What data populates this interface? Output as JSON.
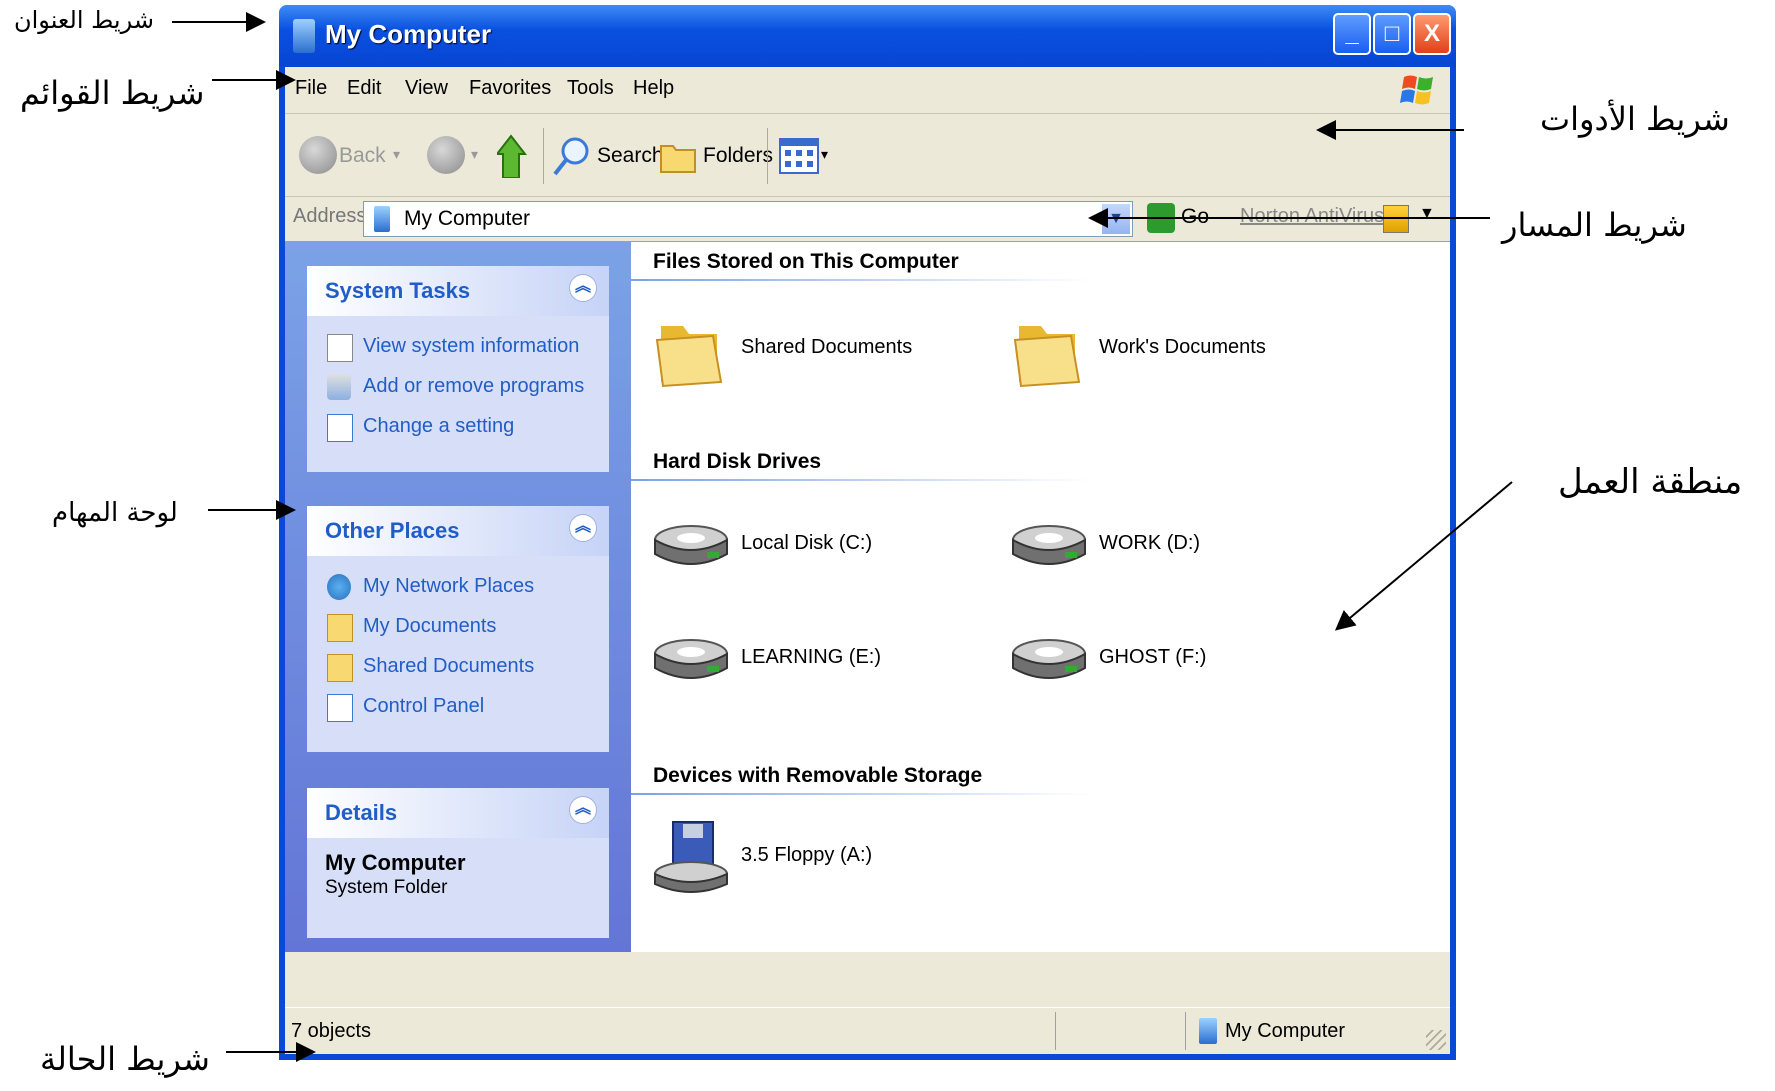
{
  "annotations": {
    "title_bar": "شريط العنوان",
    "menu_bar": "شريط القوائم",
    "toolbar": "شريط الأدوات",
    "address_bar": "شريط المسار",
    "task_pane": "لوحة المهام",
    "work_area": "منطقة العمل",
    "status_bar": "شريط الحالة"
  },
  "window": {
    "title": "My Computer",
    "buttons": {
      "minimize": "_",
      "maximize": "□",
      "close": "X"
    }
  },
  "menubar": {
    "items": [
      "File",
      "Edit",
      "View",
      "Favorites",
      "Tools",
      "Help"
    ]
  },
  "toolbar": {
    "back": "Back",
    "search": "Search",
    "folders": "Folders"
  },
  "address": {
    "label": "Address",
    "value": "My Computer",
    "go": "Go",
    "norton": "Norton AntiVirus"
  },
  "taskpane": {
    "system_tasks": {
      "title": "System Tasks",
      "items": [
        "View system information",
        "Add or remove programs",
        "Change a setting"
      ]
    },
    "other_places": {
      "title": "Other Places",
      "items": [
        "My Network Places",
        "My Documents",
        "Shared Documents",
        "Control Panel"
      ]
    },
    "details": {
      "title": "Details",
      "name": "My Computer",
      "type": "System Folder"
    }
  },
  "content": {
    "groups": [
      {
        "title": "Files Stored on This Computer",
        "items": [
          "Shared Documents",
          "Work's Documents"
        ]
      },
      {
        "title": "Hard Disk Drives",
        "items": [
          "Local Disk (C:)",
          "WORK (D:)",
          "LEARNING (E:)",
          "GHOST (F:)"
        ]
      },
      {
        "title": "Devices with Removable Storage",
        "items": [
          "3.5 Floppy (A:)"
        ]
      }
    ]
  },
  "status": {
    "objects": "7 objects",
    "location": "My Computer"
  },
  "colors": {
    "titlebar": "#0a50e0",
    "taskpane": "#6f8bdc",
    "link": "#215dc6",
    "chrome": "#ece9d8"
  }
}
